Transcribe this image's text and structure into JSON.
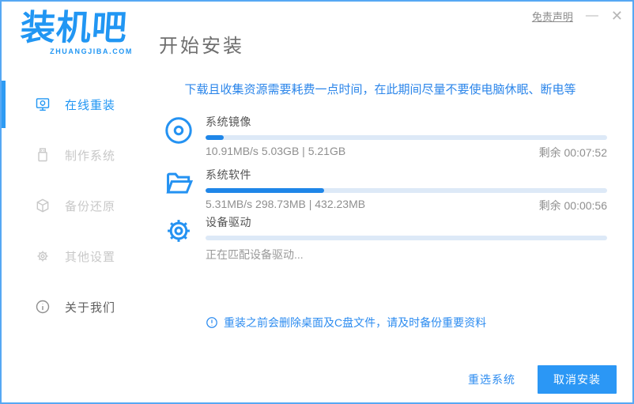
{
  "header": {
    "logo_text": "装机吧",
    "logo_domain": "ZHUANGJIBA.COM",
    "page_title": "开始安装",
    "disclaimer_label": "免责声明",
    "minimize_glyph": "—",
    "close_glyph": "✕"
  },
  "sidebar": {
    "items": [
      {
        "label": "在线重装",
        "icon": "monitor-icon",
        "active": true
      },
      {
        "label": "制作系统",
        "icon": "usb-icon",
        "active": false
      },
      {
        "label": "备份还原",
        "icon": "backup-icon",
        "active": false
      },
      {
        "label": "其他设置",
        "icon": "gear-icon",
        "active": false
      },
      {
        "label": "关于我们",
        "icon": "info-icon",
        "active": false
      }
    ]
  },
  "main": {
    "notice": "下载且收集资源需要耗费一点时间，在此期间尽量不要使电脑休眠、断电等",
    "tasks": [
      {
        "label": "系统镜像",
        "stats": "10.91MB/s 5.03GB | 5.21GB",
        "remaining": "剩余 00:07:52",
        "progress_percent": 4.5,
        "fill_style": "width:4.5%"
      },
      {
        "label": "系统软件",
        "stats": "5.31MB/s 298.73MB | 432.23MB",
        "remaining": "剩余 00:00:56",
        "progress_percent": 29.5,
        "fill_style": "width:29.5%"
      },
      {
        "label": "设备驱动",
        "status": "正在匹配设备驱动...",
        "progress_percent": 0,
        "fill_style": "width:0%"
      }
    ],
    "backup_warning": "重装之前会删除桌面及C盘文件，请及时备份重要资料"
  },
  "footer": {
    "reselect_label": "重选系统",
    "cancel_label": "取消安装"
  },
  "colors": {
    "accent_blue": "#2196f3",
    "progress_fill": "#1f86e8",
    "progress_track": "#dde9f7",
    "notice_blue": "#2c86ea",
    "inactive_gray": "#c8c8c8",
    "border_blue": "#56a8f4"
  }
}
